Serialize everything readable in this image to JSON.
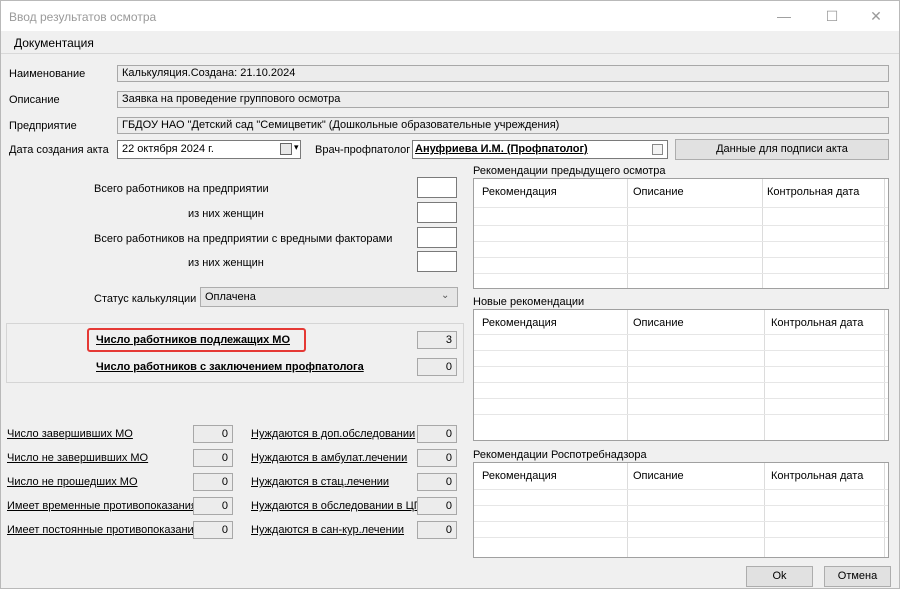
{
  "window": {
    "title": "Ввод результатов осмотра",
    "minimize": "—",
    "maximize": "☐",
    "close": "✕"
  },
  "menu": {
    "documentation": "Документация"
  },
  "fields": {
    "name_label": "Наименование",
    "name_value": "Калькуляция.Создана: 21.10.2024",
    "description_label": "Описание",
    "description_value": "Заявка на проведение группового осмотра",
    "enterprise_label": "Предприятие",
    "enterprise_value": "ГБДОУ НАО \"Детский сад \"Семицветик\" (Дошкольные образовательные учреждения)",
    "act_date_label": "Дата создания акта",
    "act_date_value": "22  октября  2024 г.",
    "doctor_label": "Врач-профпатолог",
    "doctor_value": "Ануфриева И.М. (Профпатолог)",
    "sign_data_button": "Данные для подписи акта"
  },
  "workers": {
    "total_label": "Всего работников на предприятии",
    "women_label": "из них женщин",
    "harmful_label": "Всего работников на предприятии с вредными факторами",
    "harmful_women_label": "из них женщин",
    "total_value": "",
    "women_value": "",
    "harmful_value": "",
    "harmful_women_value": ""
  },
  "status": {
    "label": "Статус калькуляции",
    "value": "Оплачена"
  },
  "counts": {
    "subject_label": "Число работников подлежащих МО",
    "subject_value": "3",
    "conclusion_label": "Число работников с заключением профпатолога",
    "conclusion_value": "0"
  },
  "left_stats": [
    {
      "label": "Число завершивших МО",
      "value": "0"
    },
    {
      "label": "Число не завершивших МО",
      "value": "0"
    },
    {
      "label": "Число не прошедших МО",
      "value": "0"
    },
    {
      "label": "Имеет временные противопоказания",
      "value": "0"
    },
    {
      "label": "Имеет постоянные противопоказания",
      "value": "0"
    }
  ],
  "right_stats": [
    {
      "label": "Нуждаются в доп.обследовании",
      "value": "0"
    },
    {
      "label": "Нуждаются в амбулат.лечении",
      "value": "0"
    },
    {
      "label": "Нуждаются в стац.лечении",
      "value": "0"
    },
    {
      "label": "Нуждаются в обследовании в ЦП",
      "value": "0"
    },
    {
      "label": "Нуждаются в сан-кур.лечении",
      "value": "0"
    }
  ],
  "grids": {
    "previous": {
      "title": "Рекомендации предыдущего осмотра",
      "columns": [
        "Рекомендация",
        "Описание",
        "Контрольная дата"
      ]
    },
    "new": {
      "title": "Новые рекомендации",
      "columns": [
        "Рекомендация",
        "Описание",
        "Контрольная дата"
      ]
    },
    "rospotreb": {
      "title": "Рекомендации Роспотребнадзора",
      "columns": [
        "Рекомендация",
        "Описание",
        "Контрольная дата"
      ]
    }
  },
  "buttons": {
    "ok": "Ok",
    "cancel": "Отмена"
  },
  "colors": {
    "highlight": "#e53935",
    "window_bg": "#f0f0f0"
  }
}
